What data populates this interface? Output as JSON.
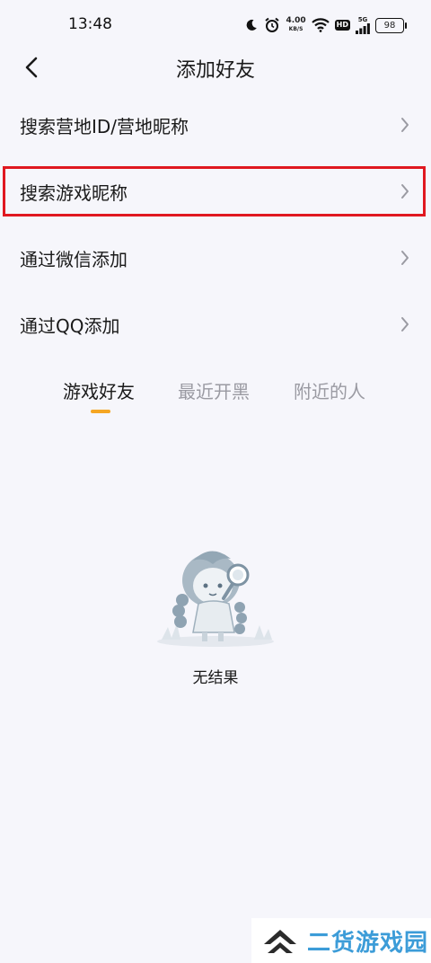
{
  "status_bar": {
    "time": "13:48",
    "net_speed_value": "4.00",
    "net_speed_unit": "KB/S",
    "hd_label": "HD",
    "network_label": "5G",
    "battery": "98"
  },
  "header": {
    "title": "添加好友"
  },
  "menu": {
    "items": [
      {
        "label": "搜索营地ID/营地昵称"
      },
      {
        "label": "搜索游戏昵称"
      },
      {
        "label": "通过微信添加"
      },
      {
        "label": "通过QQ添加"
      }
    ]
  },
  "tabs": [
    {
      "label": "游戏好友",
      "active": true
    },
    {
      "label": "最近开黑",
      "active": false
    },
    {
      "label": "附近的人",
      "active": false
    }
  ],
  "empty_state": {
    "text": "无结果"
  },
  "watermark": {
    "text": "二货游戏园"
  },
  "colors": {
    "background": "#f6f6fb",
    "highlight_border": "#e01820",
    "tab_indicator": "#f5a623",
    "tab_inactive": "#9a9aa2",
    "watermark_blue": "#3c9cd8"
  }
}
